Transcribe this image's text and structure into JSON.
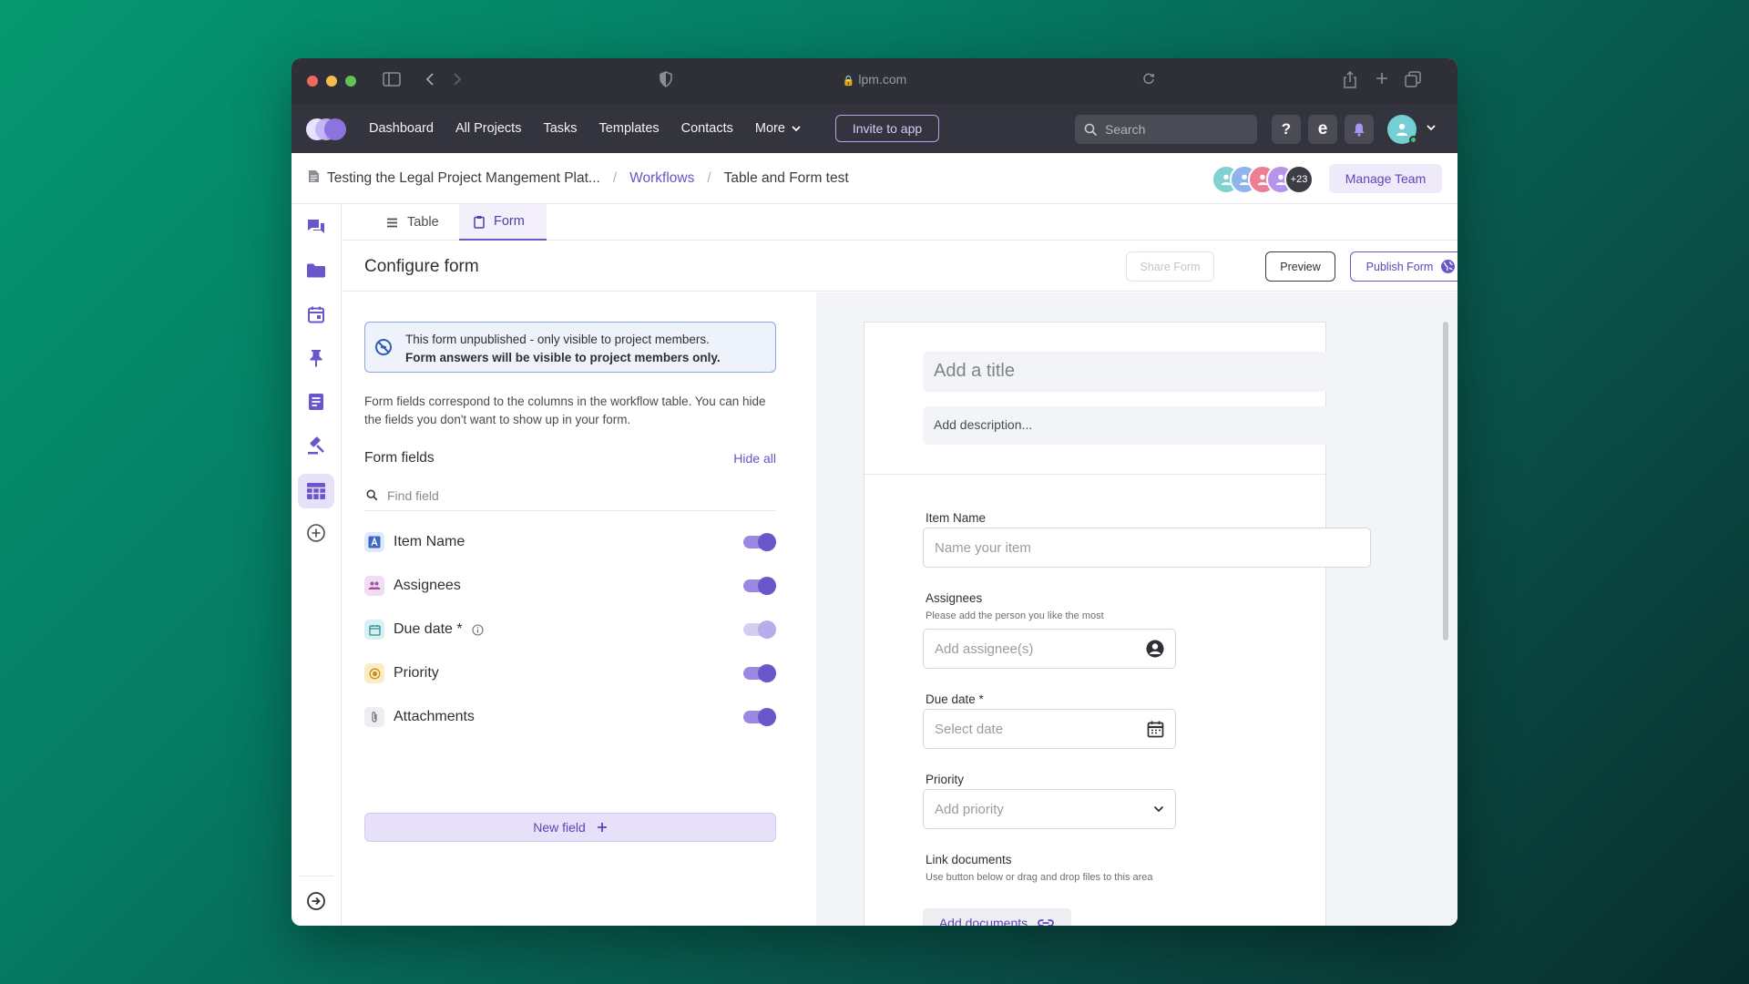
{
  "browser": {
    "url": "lpm.com",
    "traffic_colors": [
      "#ee6a5e",
      "#f5bd4f",
      "#61c454"
    ]
  },
  "header": {
    "nav": [
      {
        "label": "Dashboard"
      },
      {
        "label": "All Projects"
      },
      {
        "label": "Tasks"
      },
      {
        "label": "Templates"
      },
      {
        "label": "Contacts"
      },
      {
        "label": "More"
      }
    ],
    "invite_label": "Invite to app",
    "search_placeholder": "Search",
    "help_label": "?",
    "e_label": "e"
  },
  "breadcrumb": {
    "project": "Testing the Legal Project Mangement Plat...",
    "section": "Workflows",
    "current": "Table and Form test"
  },
  "team": {
    "extra_count": "+23",
    "manage_label": "Manage Team"
  },
  "tabs": [
    {
      "label": "Table"
    },
    {
      "label": "Form"
    }
  ],
  "config": {
    "title": "Configure form",
    "share_label": "Share Form",
    "preview_label": "Preview",
    "publish_label": "Publish Form"
  },
  "notice": {
    "line1": "This form unpublished - only visible to project members.",
    "line2": "Form answers will be visible to project members only."
  },
  "help_text": "Form fields correspond to the columns in the workflow table. You can hide the fields you don't want to show up in your form.",
  "form_fields": {
    "heading": "Form fields",
    "hide_all": "Hide all",
    "find_placeholder": "Find field",
    "items": [
      {
        "label": "Item Name",
        "icon": "text-icon",
        "enabled": true
      },
      {
        "label": "Assignees",
        "icon": "people-icon",
        "enabled": true
      },
      {
        "label": "Due date *",
        "icon": "calendar-icon",
        "enabled": true,
        "locked": true
      },
      {
        "label": "Priority",
        "icon": "priority-icon",
        "enabled": true
      },
      {
        "label": "Attachments",
        "icon": "paperclip-icon",
        "enabled": true
      }
    ],
    "new_field_label": "New field"
  },
  "preview": {
    "title_placeholder": "Add a title",
    "description_placeholder": "Add description...",
    "item_name": {
      "label": "Item Name",
      "placeholder": "Name your item"
    },
    "assignees": {
      "label": "Assignees",
      "hint": "Please add the person you like the most",
      "placeholder": "Add assignee(s)"
    },
    "due_date": {
      "label": "Due date *",
      "placeholder": "Select date"
    },
    "priority": {
      "label": "Priority",
      "placeholder": "Add priority"
    },
    "link_documents": {
      "label": "Link documents",
      "hint": "Use button below or drag and drop files to this area",
      "button": "Add documents"
    }
  },
  "colors": {
    "accent": "#6a55c9",
    "accent_light": "#e6e0f8",
    "header_bg": "#33343d"
  }
}
